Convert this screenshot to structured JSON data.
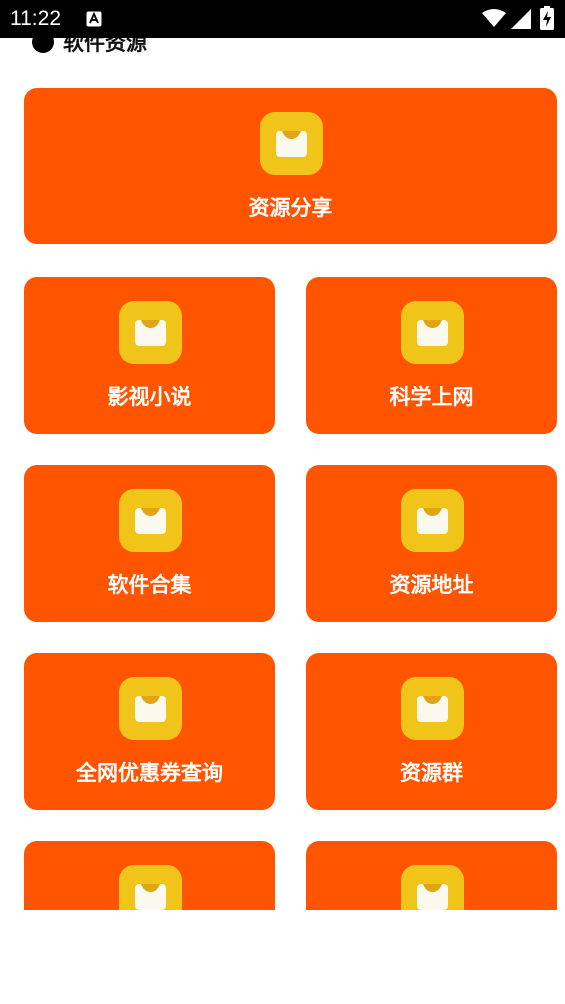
{
  "status_bar": {
    "time": "11:22"
  },
  "section": {
    "title": "软件资源"
  },
  "colors": {
    "tile_bg": "#ff5500",
    "icon_bg": "#f0c419",
    "icon_inner": "#fbf8ee"
  },
  "tiles": {
    "t0": {
      "label": "资源分享",
      "icon": "box-icon"
    },
    "t1": {
      "label": "影视小说",
      "icon": "box-icon"
    },
    "t2": {
      "label": "科学上网",
      "icon": "box-icon"
    },
    "t3": {
      "label": "软件合集",
      "icon": "box-icon"
    },
    "t4": {
      "label": "资源地址",
      "icon": "box-icon"
    },
    "t5": {
      "label": "全网优惠券查询",
      "icon": "box-icon"
    },
    "t6": {
      "label": "资源群",
      "icon": "box-icon"
    },
    "t7": {
      "label": "",
      "icon": "box-icon"
    },
    "t8": {
      "label": "",
      "icon": "box-icon"
    }
  }
}
